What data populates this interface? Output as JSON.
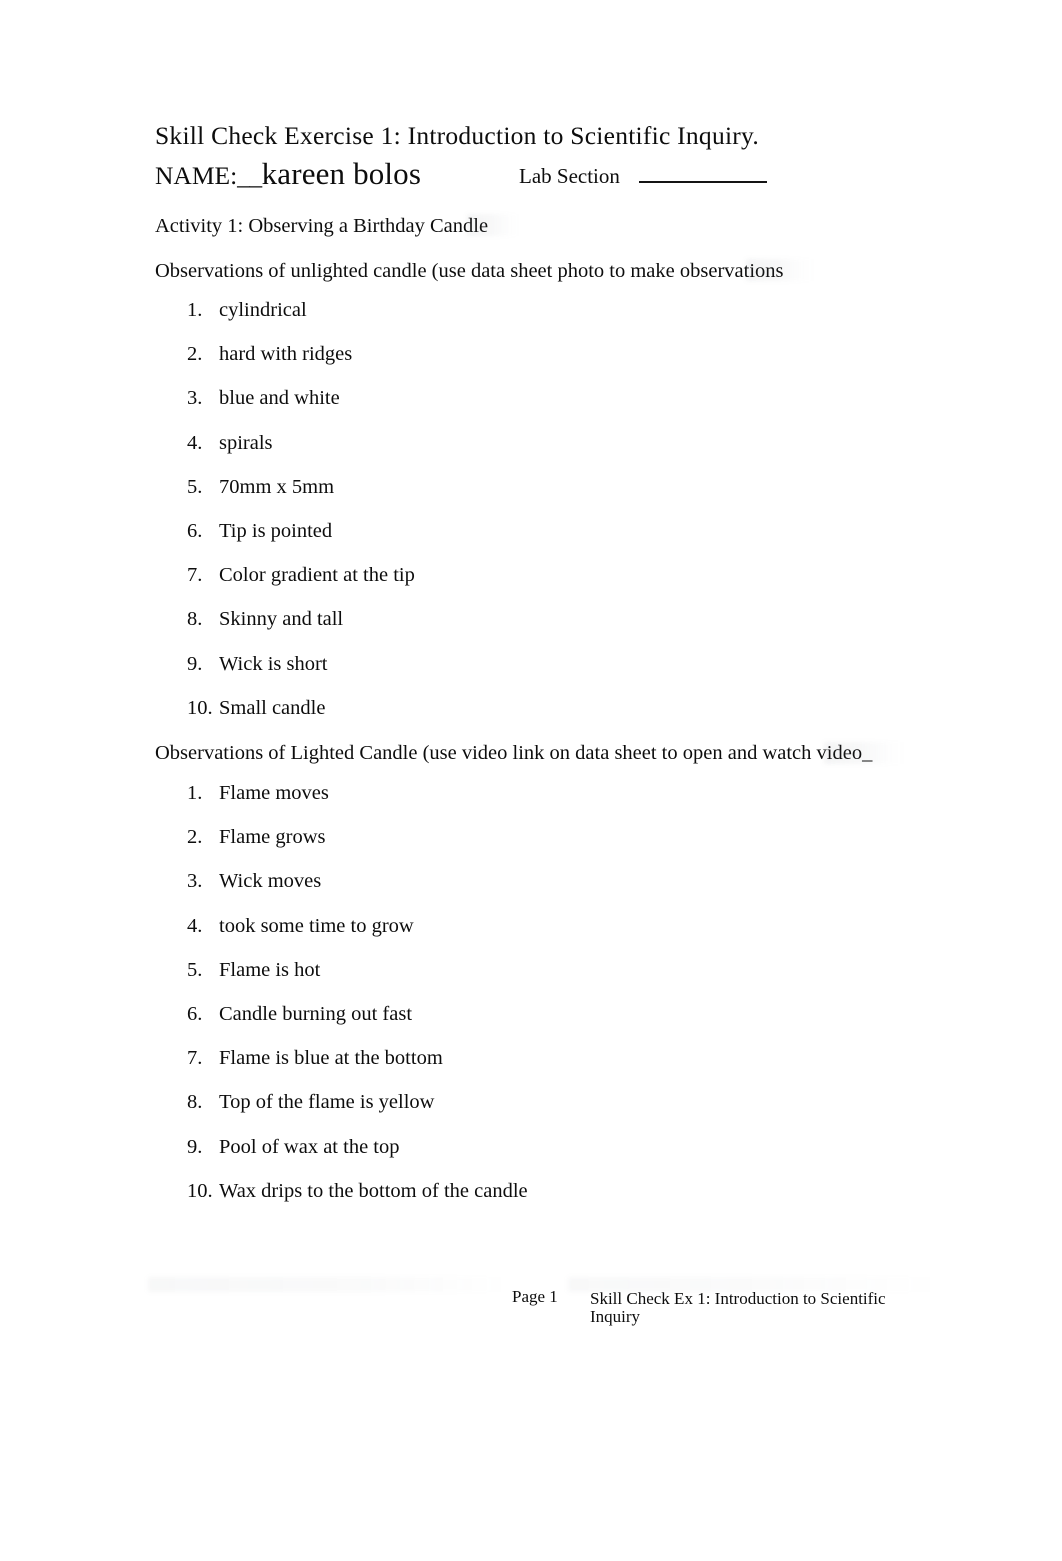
{
  "document": {
    "title": "Skill Check Exercise 1: Introduction to Scientific Inquiry.",
    "name_label": "NAME:",
    "name_blank": "__",
    "name_value": "kareen bolos",
    "lab_section_label": "Lab Section",
    "lab_section_value": ""
  },
  "sections": {
    "activity_heading": "Activity 1: Observing a Birthday Candle",
    "unlighted_heading": "Observations of unlighted candle (use data sheet photo to make observations",
    "lighted_heading": "Observations of Lighted Candle (use video link on data sheet to open and watch video_"
  },
  "unlighted_observations": [
    {
      "number": "1.",
      "text": "cylindrical"
    },
    {
      "number": "2.",
      "text": "hard with ridges"
    },
    {
      "number": "3.",
      "text": "blue and white"
    },
    {
      "number": "4.",
      "text": "spirals"
    },
    {
      "number": "5.",
      "text": "70mm x 5mm"
    },
    {
      "number": "6.",
      "text": "Tip is pointed"
    },
    {
      "number": "7.",
      "text": "Color gradient at the tip"
    },
    {
      "number": "8.",
      "text": "Skinny and tall"
    },
    {
      "number": "9.",
      "text": "Wick is short"
    },
    {
      "number": "10.",
      "text": "Small candle"
    }
  ],
  "lighted_observations": [
    {
      "number": "1.",
      "text": "Flame moves"
    },
    {
      "number": "2.",
      "text": "Flame grows"
    },
    {
      "number": "3.",
      "text": "Wick moves"
    },
    {
      "number": "4.",
      "text": " took some time to grow"
    },
    {
      "number": "5.",
      "text": "Flame is hot"
    },
    {
      "number": "6.",
      "text": "Candle burning out fast"
    },
    {
      "number": "7.",
      "text": "Flame is blue at the bottom"
    },
    {
      "number": "8.",
      "text": "Top of the flame is yellow"
    },
    {
      "number": "9.",
      "text": "Pool of wax at the top"
    },
    {
      "number": "10.",
      "text": "Wax drips to the bottom of the candle"
    }
  ],
  "footer": {
    "page_number": "Page 1",
    "doc_reference_line1": "Skill Check Ex 1: Introduction to Scientific",
    "doc_reference_line2": "Inquiry"
  }
}
